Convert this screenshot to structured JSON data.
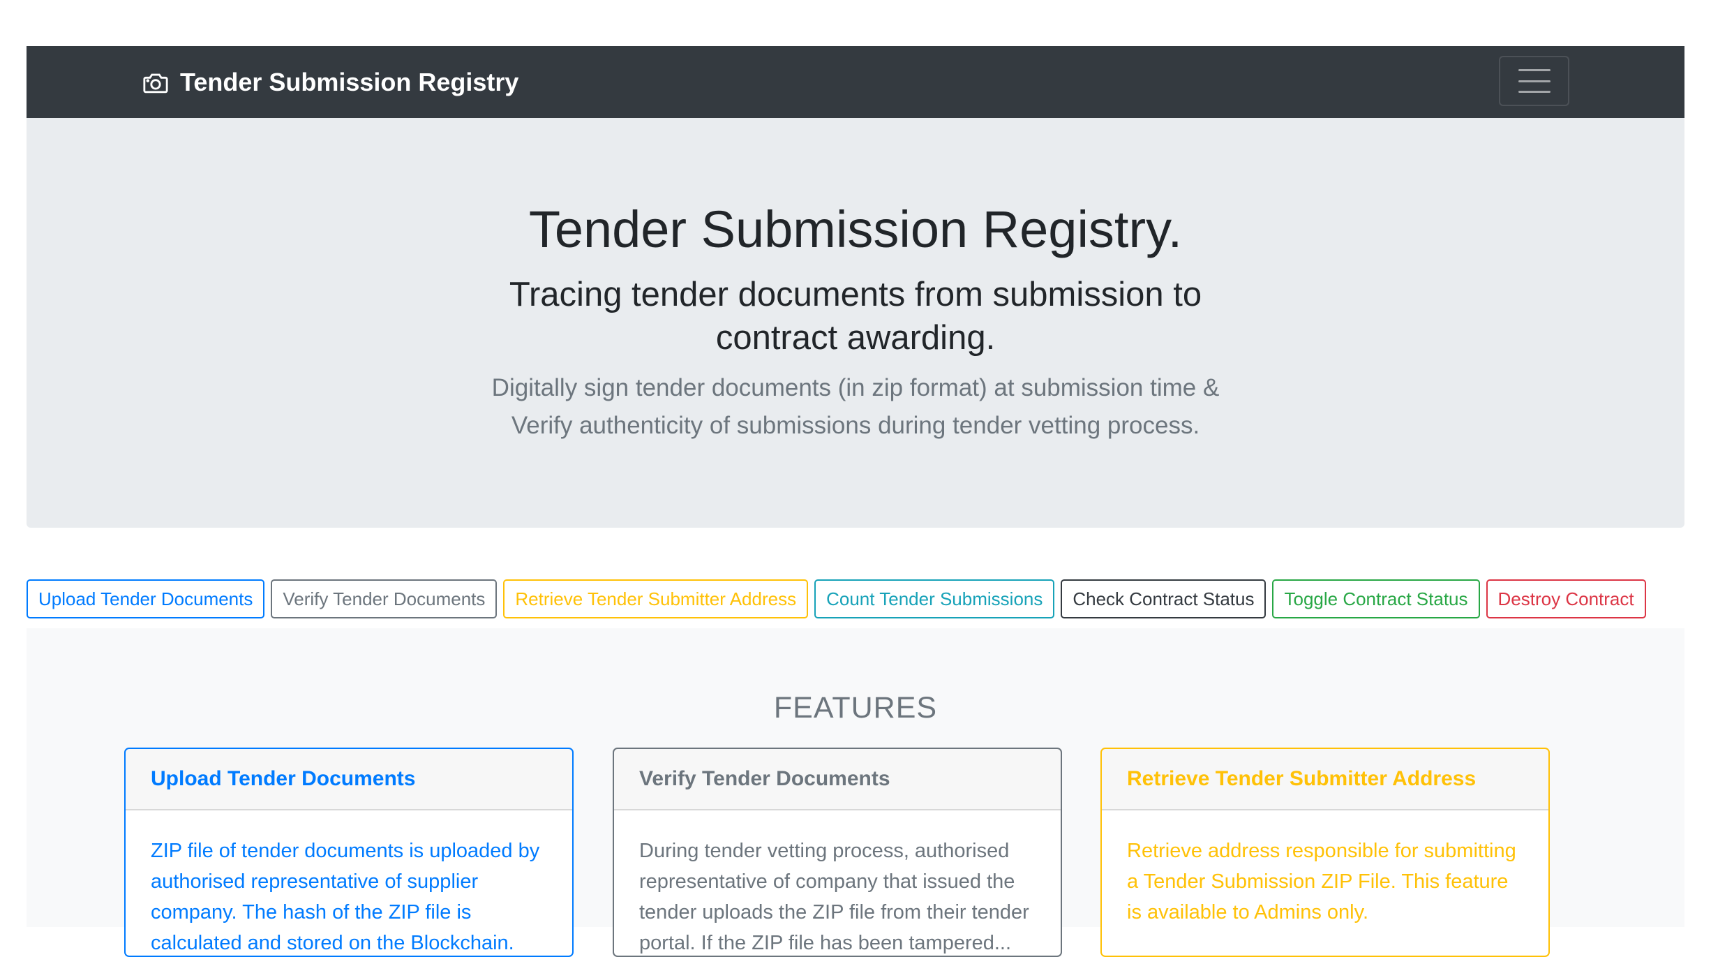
{
  "navbar": {
    "brand": "Tender Submission Registry",
    "brand_icon": "camera-icon",
    "toggler_icon": "hamburger-menu-icon"
  },
  "hero": {
    "title": "Tender Submission Registry.",
    "subtitle": "Tracing tender documents from submission to contract awarding.",
    "lead": "Digitally sign tender documents (in zip format) at submission time & Verify authenticity of submissions during tender vetting process."
  },
  "actions": [
    {
      "label": "Upload Tender Documents",
      "color": "#007bff"
    },
    {
      "label": "Verify Tender Documents",
      "color": "#6c757d"
    },
    {
      "label": "Retrieve Tender Submitter Address",
      "color": "#ffc107"
    },
    {
      "label": "Count Tender Submissions",
      "color": "#17a2b8"
    },
    {
      "label": "Check Contract Status",
      "color": "#343a40"
    },
    {
      "label": "Toggle Contract Status",
      "color": "#28a745"
    },
    {
      "label": "Destroy Contract",
      "color": "#dc3545"
    }
  ],
  "features": {
    "heading": "FEATURES",
    "cards": [
      {
        "title": "Upload Tender Documents",
        "body": "ZIP file of tender documents is uploaded by authorised representative of supplier company. The hash of the ZIP file is calculated and stored on the Blockchain.",
        "color": "#007bff"
      },
      {
        "title": "Verify Tender Documents",
        "body": "During tender vetting process, authorised representative of company that issued the tender uploads the ZIP file from their tender portal. If the ZIP file has been tampered...",
        "color": "#6c757d"
      },
      {
        "title": "Retrieve Tender Submitter Address",
        "body": "Retrieve address responsible for submitting a Tender Submission ZIP File. This feature is available to Admins only.",
        "color": "#ffc107"
      }
    ]
  }
}
